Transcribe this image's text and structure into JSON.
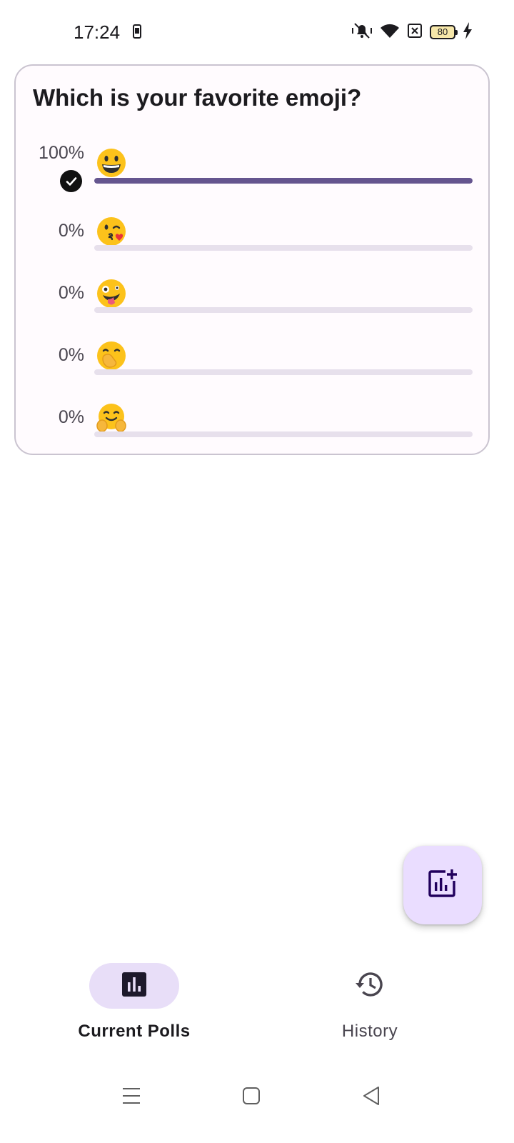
{
  "status_bar": {
    "time": "17:24",
    "battery_level": "80",
    "icons": [
      "notification-icon",
      "vibrate-icon",
      "wifi-icon",
      "no-sim-icon",
      "battery-icon",
      "charging-icon"
    ]
  },
  "poll": {
    "question": "Which is your favorite emoji?",
    "options": [
      {
        "emoji": "grinning-face",
        "percent_label": "100%",
        "share": 1.0,
        "selected": true
      },
      {
        "emoji": "face-blowing-kiss",
        "percent_label": "0%",
        "share": 0.0,
        "selected": false
      },
      {
        "emoji": "zany-face",
        "percent_label": "0%",
        "share": 0.0,
        "selected": false
      },
      {
        "emoji": "face-with-hand-over-mouth",
        "percent_label": "0%",
        "share": 0.0,
        "selected": false
      },
      {
        "emoji": "hugging-face",
        "percent_label": "0%",
        "share": 0.0,
        "selected": false
      }
    ]
  },
  "fab": {
    "icon": "add-chart-icon"
  },
  "bottom_nav": {
    "items": [
      {
        "label": "Current Polls",
        "icon": "bar-chart-icon",
        "active": true
      },
      {
        "label": "History",
        "icon": "history-icon",
        "active": false
      }
    ]
  },
  "system_nav": {
    "buttons": [
      "menu-icon",
      "home-icon",
      "back-icon"
    ]
  },
  "colors": {
    "accent": "#65558f",
    "track": "#e7e0ec",
    "fab_bg": "#eaddff",
    "nav_active_bg": "#e8def8",
    "card_border": "#cac4d0"
  }
}
